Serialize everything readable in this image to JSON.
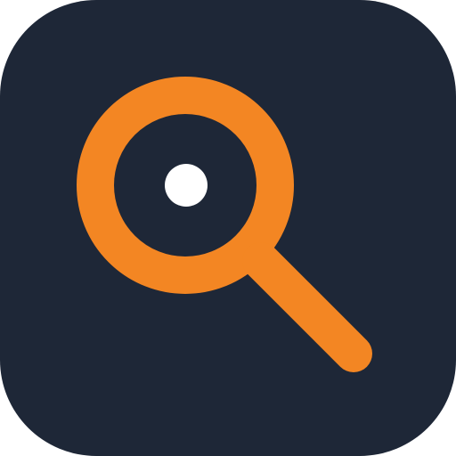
{
  "icon": {
    "name": "search-icon",
    "description": "",
    "colors": {
      "background": "#1E2737",
      "accent": "#F38623",
      "dot": "#FFFFFF"
    }
  }
}
